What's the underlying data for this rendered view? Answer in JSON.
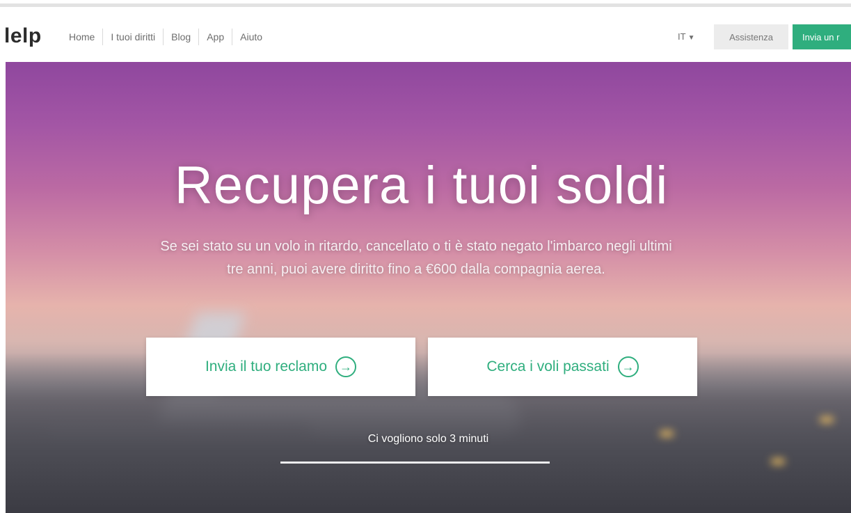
{
  "header": {
    "logo": "lelp",
    "nav": [
      "Home",
      "I tuoi diritti",
      "Blog",
      "App",
      "Aiuto"
    ],
    "language": "IT",
    "assistance_label": "Assistenza",
    "send_label": "Invia un r"
  },
  "hero": {
    "title": "Recupera i tuoi soldi",
    "subtitle": "Se sei stato su un volo in ritardo, cancellato o ti è stato negato l'imbarco negli ultimi tre anni, puoi avere diritto fino a €600 dalla compagnia aerea.",
    "cta_primary": "Invia il tuo reclamo",
    "cta_secondary": "Cerca i voli passati",
    "time_note": "Ci vogliono solo 3 minuti"
  },
  "colors": {
    "accent": "#2fae7e",
    "hero_top": "#8f479e",
    "hero_mid": "#e6b3ac"
  },
  "icons": {
    "arrow": "arrow-right-circle-icon",
    "caret": "caret-down-icon"
  }
}
